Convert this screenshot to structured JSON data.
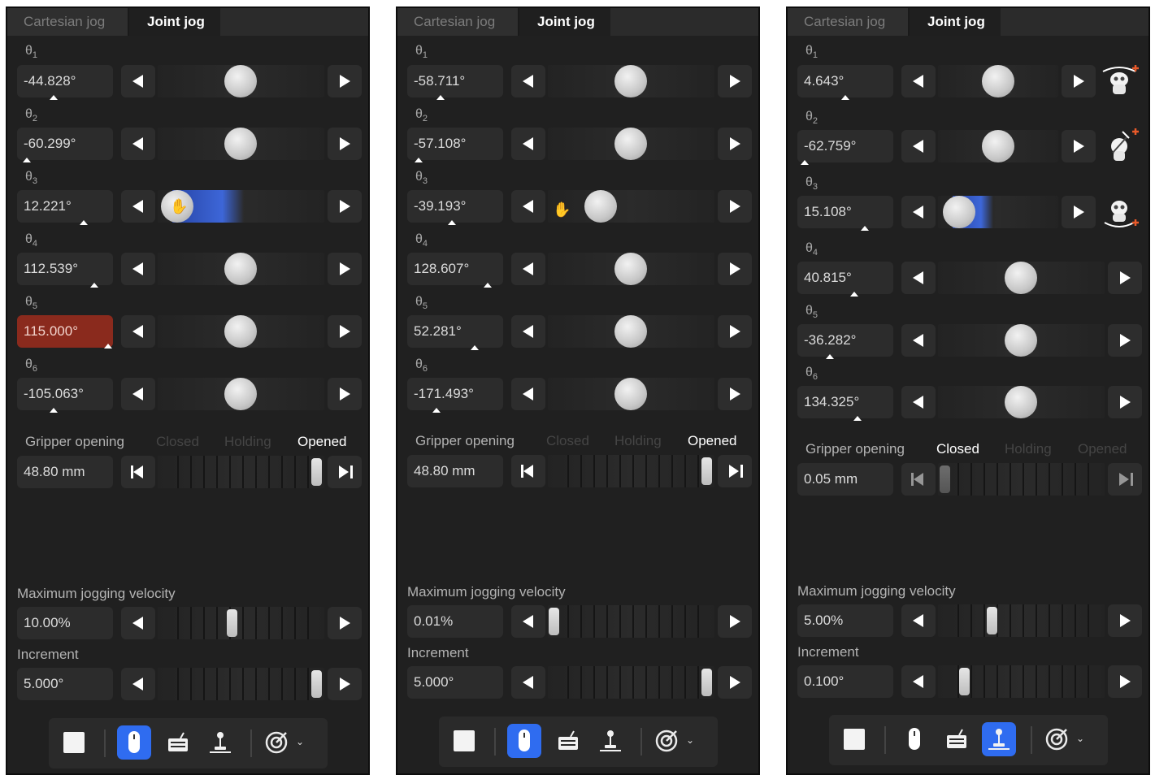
{
  "tabs": {
    "cartesian": "Cartesian jog",
    "joint": "Joint jog"
  },
  "joint_symbol": "θ",
  "joints": [
    "1",
    "2",
    "3",
    "4",
    "5",
    "6"
  ],
  "gripper": {
    "title": "Gripper opening",
    "states": [
      "Closed",
      "Holding",
      "Opened"
    ]
  },
  "velocity_title": "Maximum jogging velocity",
  "increment_title": "Increment",
  "panels": [
    {
      "values": [
        "-44.828°",
        "-60.299°",
        "12.221°",
        "112.539°",
        "115.000°",
        "-105.063°"
      ],
      "gripper_value": "48.80 mm",
      "gripper_state": "Opened",
      "velocity": "10.00%",
      "increment": "5.000°",
      "active_tool": "mouse"
    },
    {
      "values": [
        "-58.711°",
        "-57.108°",
        "-39.193°",
        "128.607°",
        "52.281°",
        "-171.493°"
      ],
      "gripper_value": "48.80 mm",
      "gripper_state": "Opened",
      "velocity": "0.01%",
      "increment": "5.000°",
      "active_tool": "mouse"
    },
    {
      "values": [
        "4.643°",
        "-62.759°",
        "15.108°",
        "40.815°",
        "-36.282°",
        "134.325°"
      ],
      "gripper_value": "0.05 mm",
      "gripper_state": "Closed",
      "velocity": "5.00%",
      "increment": "0.100°",
      "active_tool": "joystick"
    }
  ],
  "icons": {
    "stop": "stop-square-icon",
    "mouse": "mouse-icon",
    "keyboard": "keyboard-icon",
    "joystick": "joystick-icon",
    "target": "target-icon",
    "chevron": "chevron-down-icon",
    "robot": "robot-joint-icon",
    "hand": "grab-hand-icon"
  },
  "colors": {
    "accent": "#2f6cf0",
    "error": "#8a2a1d",
    "background": "#202020"
  }
}
